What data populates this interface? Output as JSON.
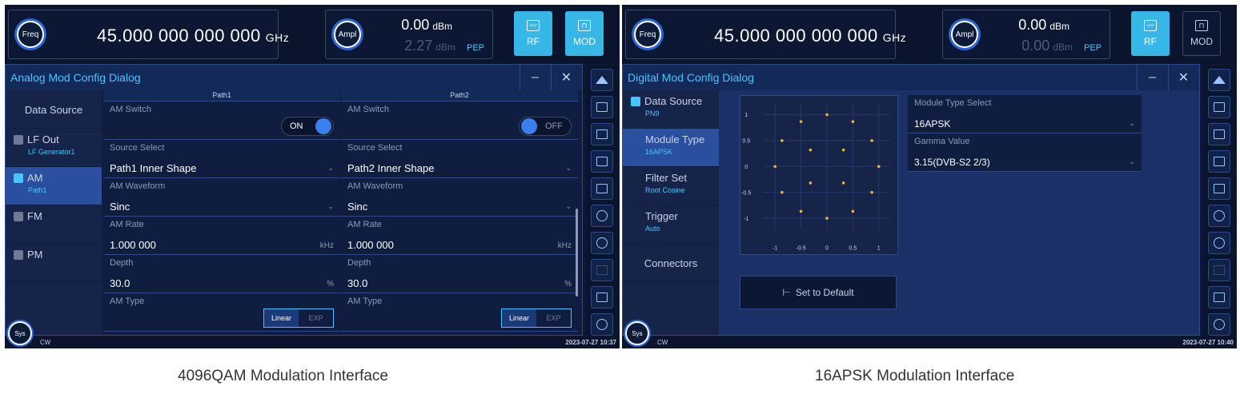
{
  "left": {
    "freq": {
      "knob": "Freq",
      "value": "45.000 000 000 000",
      "unit": "GHz"
    },
    "ampl": {
      "knob": "Ampl",
      "value": "0.00",
      "unit": "dBm",
      "pep_value": "2.27",
      "pep_unit": "dBm",
      "pep_label": "PEP"
    },
    "rf": {
      "label": "RF",
      "active": true
    },
    "mod": {
      "label": "MOD",
      "active": true
    },
    "dialog_title": "Analog Mod Config Dialog",
    "sidebar": [
      {
        "label": "Data Source",
        "sub": ""
      },
      {
        "label": "LF Out",
        "sub": "LF Generator1"
      },
      {
        "label": "AM",
        "sub": "Path1"
      },
      {
        "label": "FM",
        "sub": ""
      },
      {
        "label": "PM",
        "sub": ""
      }
    ],
    "paths": [
      {
        "header": "Path1",
        "am_switch_label": "AM Switch",
        "am_switch_state": "ON",
        "source_label": "Source Select",
        "source_value": "Path1 Inner Shape",
        "waveform_label": "AM Waveform",
        "waveform_value": "Sinc",
        "rate_label": "AM Rate",
        "rate_value": "1.000 000",
        "rate_unit": "kHz",
        "depth_label": "Depth",
        "depth_value": "30.0",
        "depth_unit": "%",
        "type_label": "AM Type",
        "type_opt1": "Linear",
        "type_opt2": "EXP"
      },
      {
        "header": "Path2",
        "am_switch_label": "AM Switch",
        "am_switch_state": "OFF",
        "source_label": "Source Select",
        "source_value": "Path2 Inner Shape",
        "waveform_label": "AM Waveform",
        "waveform_value": "Sinc",
        "rate_label": "AM Rate",
        "rate_value": "1.000 000",
        "rate_unit": "kHz",
        "depth_label": "Depth",
        "depth_value": "30.0",
        "depth_unit": "%",
        "type_label": "AM Type",
        "type_opt1": "Linear",
        "type_opt2": "EXP"
      }
    ],
    "status": {
      "sys": "Sys",
      "mode": "CW",
      "time": "2023-07-27 10:37"
    }
  },
  "right": {
    "freq": {
      "knob": "Freq",
      "value": "45.000 000 000 000",
      "unit": "GHz"
    },
    "ampl": {
      "knob": "Ampl",
      "value": "0.00",
      "unit": "dBm",
      "pep_value": "0.00",
      "pep_unit": "dBm",
      "pep_label": "PEP"
    },
    "rf": {
      "label": "RF",
      "active": true
    },
    "mod": {
      "label": "MOD",
      "active": false
    },
    "dialog_title": "Digital Mod Config Dialog",
    "sidebar": [
      {
        "label": "Data Source",
        "sub": "PN9"
      },
      {
        "label": "Module Type",
        "sub": "16APSK"
      },
      {
        "label": "Filter Set",
        "sub": "Root Cosine"
      },
      {
        "label": "Trigger",
        "sub": "Auto"
      },
      {
        "label": "Connectors",
        "sub": ""
      }
    ],
    "constellation": {
      "x_ticks": [
        "-1",
        "-0.5",
        "0",
        "0.5",
        "1"
      ],
      "y_ticks": [
        "1",
        "0.5",
        "0",
        "-0.5",
        "-1"
      ]
    },
    "set_default": "Set to Default",
    "module_type": {
      "label": "Module Type Select",
      "value": "16APSK"
    },
    "gamma": {
      "label": "Gamma Value",
      "value": "3.15(DVB-S2 2/3)"
    },
    "status": {
      "sys": "Sys",
      "mode": "CW",
      "time": "2023-07-27 10:40"
    }
  },
  "captions": {
    "left": "4096QAM Modulation Interface",
    "right": "16APSK Modulation Interface"
  },
  "colors": {
    "accent": "#37b6e8",
    "panel": "#0b1733",
    "highlight": "#4ac4ff",
    "point": "#f2b233"
  },
  "icons": [
    "home-icon",
    "window-icon",
    "menu-icon",
    "file-icon",
    "scpi-icon",
    "camera-icon",
    "back-icon",
    "lock-icon",
    "preset-icon",
    "help-icon"
  ]
}
